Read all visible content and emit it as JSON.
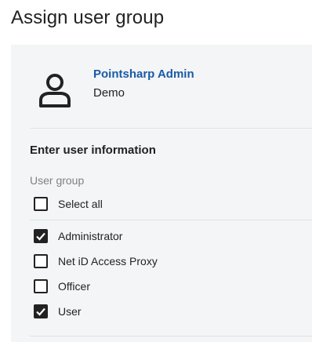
{
  "page": {
    "title": "Assign user group"
  },
  "user": {
    "name": "Pointsharp Admin",
    "organization": "Demo",
    "icon": "user-avatar-icon"
  },
  "form": {
    "section_title": "Enter user information",
    "group_label": "User group",
    "select_all": {
      "label": "Select all",
      "checked": false
    },
    "groups": [
      {
        "label": "Administrator",
        "checked": true
      },
      {
        "label": "Net iD Access Proxy",
        "checked": false
      },
      {
        "label": "Officer",
        "checked": false
      },
      {
        "label": "User",
        "checked": true
      }
    ]
  },
  "colors": {
    "link": "#1a5aa6",
    "panel": "#f3f5f6",
    "muted": "#7b8288",
    "text": "#222222"
  }
}
